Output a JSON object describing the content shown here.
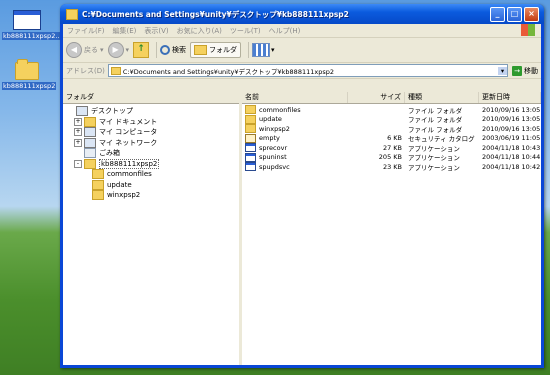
{
  "desktop": {
    "icons": [
      {
        "label": "kb888111xpsp2...",
        "kind": "window"
      },
      {
        "label": "kb888111xpsp2",
        "kind": "folder"
      }
    ]
  },
  "window": {
    "title": "C:¥Documents and Settings¥unity¥デスクトップ¥kb888111xpsp2",
    "buttons": {
      "minimize": "_",
      "maximize": "□",
      "close": "×"
    }
  },
  "menu": [
    "ファイル(F)",
    "編集(E)",
    "表示(V)",
    "お気に入り(A)",
    "ツール(T)",
    "ヘルプ(H)"
  ],
  "toolbar": {
    "back": "戻る",
    "search": "検索",
    "folders": "フォルダ"
  },
  "address": {
    "label": "アドレス(D)",
    "value": "C:¥Documents and Settings¥unity¥デスクトップ¥kb888111xpsp2",
    "go": "移動"
  },
  "folders_pane": {
    "header": "フォルダ",
    "tree": [
      {
        "label": "デスクトップ",
        "indent": 0,
        "toggle": "",
        "icon": "desktop"
      },
      {
        "label": "マイ ドキュメント",
        "indent": 1,
        "toggle": "+",
        "icon": "folder"
      },
      {
        "label": "マイ コンピュータ",
        "indent": 1,
        "toggle": "+",
        "icon": "computer"
      },
      {
        "label": "マイ ネットワーク",
        "indent": 1,
        "toggle": "+",
        "icon": "network"
      },
      {
        "label": "ごみ箱",
        "indent": 1,
        "toggle": "",
        "icon": "trash"
      },
      {
        "label": "kb888111xpsp2",
        "indent": 1,
        "toggle": "-",
        "icon": "folder",
        "selected": true
      },
      {
        "label": "commonfiles",
        "indent": 2,
        "toggle": "",
        "icon": "folder"
      },
      {
        "label": "update",
        "indent": 2,
        "toggle": "",
        "icon": "folder"
      },
      {
        "label": "winxpsp2",
        "indent": 2,
        "toggle": "",
        "icon": "folder"
      }
    ]
  },
  "files": {
    "columns": {
      "name": "名前",
      "size": "サイズ",
      "type": "種類",
      "date": "更新日時"
    },
    "rows": [
      {
        "name": "commonfiles",
        "size": "",
        "type": "ファイル フォルダ",
        "date": "2010/09/16 13:05",
        "icon": "folder"
      },
      {
        "name": "update",
        "size": "",
        "type": "ファイル フォルダ",
        "date": "2010/09/16 13:05",
        "icon": "folder"
      },
      {
        "name": "winxpsp2",
        "size": "",
        "type": "ファイル フォルダ",
        "date": "2010/09/16 13:05",
        "icon": "folder"
      },
      {
        "name": "empty",
        "size": "6 KB",
        "type": "セキュリティ カタログ",
        "date": "2003/06/19 11:05",
        "icon": "cat"
      },
      {
        "name": "sprecovr",
        "size": "27 KB",
        "type": "アプリケーション",
        "date": "2004/11/18 10:43",
        "icon": "app"
      },
      {
        "name": "spuninst",
        "size": "205 KB",
        "type": "アプリケーション",
        "date": "2004/11/18 10:44",
        "icon": "app"
      },
      {
        "name": "spupdsvc",
        "size": "23 KB",
        "type": "アプリケーション",
        "date": "2004/11/18 10:42",
        "icon": "app"
      }
    ]
  }
}
